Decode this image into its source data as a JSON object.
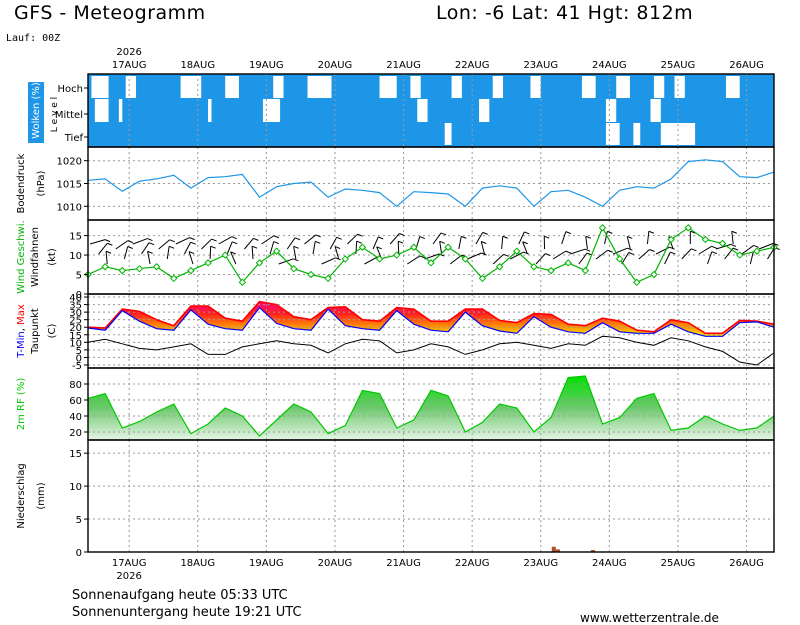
{
  "header": {
    "title_left": "GFS - Meteogramm",
    "title_right": "Lon: -6 Lat: 41 Hgt: 812m",
    "run": "Lauf: 00Z"
  },
  "footer": {
    "sunrise": "Sonnenaufgang heute 05:33 UTC",
    "sunset": "Sonnenuntergang heute 19:21 UTC",
    "website": "www.wetterzentrale.de"
  },
  "colors": {
    "cloud_sky": "#1E96E8",
    "pressure": "#1E96E8",
    "wind": "#00B400",
    "tmin": "#0000FF",
    "tmax": "#FF0000",
    "humidity": "#00C800",
    "precip": "#B45028",
    "grid": "#9A9A9A"
  },
  "chart_data": [
    {
      "type": "heatmap",
      "panel": "clouds",
      "ylabel": "Wolken (%)",
      "levels": [
        "Hoch",
        "Mittel",
        "Tief"
      ],
      "level_axis_label": "L e v e l",
      "x_year": "2026",
      "x": [
        "17AUG",
        "18AUG",
        "19AUG",
        "20AUG",
        "21AUG",
        "22AUG",
        "23AUG",
        "24AUG",
        "25AUG",
        "26AUG"
      ],
      "clear_patches": [
        {
          "level": "Hoch",
          "from": 0.05,
          "to": 0.3
        },
        {
          "level": "Hoch",
          "from": 0.55,
          "to": 0.7
        },
        {
          "level": "Hoch",
          "from": 1.35,
          "to": 1.65
        },
        {
          "level": "Hoch",
          "from": 2.0,
          "to": 2.2
        },
        {
          "level": "Hoch",
          "from": 2.7,
          "to": 2.85
        },
        {
          "level": "Hoch",
          "from": 3.2,
          "to": 3.55
        },
        {
          "level": "Hoch",
          "from": 4.25,
          "to": 4.5
        },
        {
          "level": "Hoch",
          "from": 4.7,
          "to": 4.85
        },
        {
          "level": "Hoch",
          "from": 5.3,
          "to": 5.45
        },
        {
          "level": "Hoch",
          "from": 5.9,
          "to": 6.05
        },
        {
          "level": "Hoch",
          "from": 6.45,
          "to": 6.6
        },
        {
          "level": "Hoch",
          "from": 7.2,
          "to": 7.4
        },
        {
          "level": "Hoch",
          "from": 7.7,
          "to": 7.9
        },
        {
          "level": "Hoch",
          "from": 8.25,
          "to": 8.4
        },
        {
          "level": "Hoch",
          "from": 8.55,
          "to": 8.7
        },
        {
          "level": "Hoch",
          "from": 9.3,
          "to": 9.5
        },
        {
          "level": "Mittel",
          "from": 0.1,
          "to": 0.3
        },
        {
          "level": "Mittel",
          "from": 0.45,
          "to": 0.5
        },
        {
          "level": "Mittel",
          "from": 1.75,
          "to": 1.8
        },
        {
          "level": "Mittel",
          "from": 2.55,
          "to": 2.8
        },
        {
          "level": "Mittel",
          "from": 4.8,
          "to": 4.95
        },
        {
          "level": "Mittel",
          "from": 5.7,
          "to": 5.85
        },
        {
          "level": "Mittel",
          "from": 7.55,
          "to": 7.7
        },
        {
          "level": "Mittel",
          "from": 8.2,
          "to": 8.35
        },
        {
          "level": "Tief",
          "from": 5.2,
          "to": 5.3
        },
        {
          "level": "Tief",
          "from": 7.55,
          "to": 7.75
        },
        {
          "level": "Tief",
          "from": 7.95,
          "to": 8.05
        },
        {
          "level": "Tief",
          "from": 8.35,
          "to": 8.85
        }
      ]
    },
    {
      "type": "line",
      "panel": "pressure",
      "ylabel": "Bodendruck",
      "unit": "(hPa)",
      "ylim": [
        1007,
        1023
      ],
      "yticks": [
        1010,
        1015,
        1020
      ],
      "x_day_offset": [
        0,
        0.25,
        0.5,
        0.75,
        1,
        1.25,
        1.5,
        1.75,
        2,
        2.25,
        2.5,
        2.75,
        3,
        3.25,
        3.5,
        3.75,
        4,
        4.25,
        4.5,
        4.75,
        5,
        5.25,
        5.5,
        5.75,
        6,
        6.25,
        6.5,
        6.75,
        7,
        7.25,
        7.5,
        7.75,
        8,
        8.25,
        8.5,
        8.75,
        9,
        9.25,
        9.5,
        9.75,
        10
      ],
      "values": [
        1015.7,
        1016.0,
        1013.3,
        1015.5,
        1016.0,
        1016.8,
        1014.0,
        1016.3,
        1016.5,
        1017.0,
        1012.0,
        1014.3,
        1015.0,
        1015.3,
        1012.0,
        1013.8,
        1013.5,
        1013.0,
        1010.0,
        1013.2,
        1013.0,
        1012.7,
        1010.0,
        1014.0,
        1014.5,
        1014.0,
        1010.0,
        1013.2,
        1013.5,
        1012.0,
        1010.0,
        1013.5,
        1014.3,
        1014.0,
        1016.0,
        1019.8,
        1020.2,
        1019.8,
        1016.5,
        1016.3,
        1017.5
      ]
    },
    {
      "type": "line",
      "panel": "wind",
      "ylabel": "Wind Geschwi.",
      "ylabel2": "Windfahnen",
      "unit": "(kt)",
      "ylim": [
        0,
        19
      ],
      "yticks": [
        0,
        5,
        10,
        15
      ],
      "x_day_offset": [
        0,
        0.25,
        0.5,
        0.75,
        1,
        1.25,
        1.5,
        1.75,
        2,
        2.25,
        2.5,
        2.75,
        3,
        3.25,
        3.5,
        3.75,
        4,
        4.25,
        4.5,
        4.75,
        5,
        5.25,
        5.5,
        5.75,
        6,
        6.25,
        6.5,
        6.75,
        7,
        7.25,
        7.5,
        7.75,
        8,
        8.25,
        8.5,
        8.75,
        9,
        9.25,
        9.5,
        9.75,
        10
      ],
      "values": [
        5.0,
        7.0,
        6.0,
        6.5,
        7.0,
        4.0,
        6.0,
        8.0,
        10.0,
        3.0,
        8.0,
        11.0,
        6.5,
        5.0,
        4.0,
        9.0,
        12.0,
        9.0,
        10.0,
        12.0,
        8.0,
        12.0,
        9.0,
        4.0,
        7.0,
        11.0,
        7.0,
        6.0,
        8.0,
        6.0,
        17.0,
        9.0,
        3.0,
        5.0,
        14.0,
        17.0,
        14.0,
        13.0,
        10.0,
        11.0,
        12.0
      ]
    },
    {
      "type": "area",
      "panel": "temperature",
      "ylabel": "T-Min, Max",
      "ylabel_parts": {
        "sep": ", "
      },
      "ylabel2": "Taupunkt",
      "unit": "(C)",
      "ylim": [
        -7,
        42
      ],
      "yticks": [
        -5,
        0,
        5,
        10,
        15,
        20,
        25,
        30,
        35,
        40
      ],
      "x_day_offset": [
        0,
        0.25,
        0.5,
        0.75,
        1,
        1.25,
        1.5,
        1.75,
        2,
        2.25,
        2.5,
        2.75,
        3,
        3.25,
        3.5,
        3.75,
        4,
        4.25,
        4.5,
        4.75,
        5,
        5.25,
        5.5,
        5.75,
        6,
        6.25,
        6.5,
        6.75,
        7,
        7.25,
        7.5,
        7.75,
        8,
        8.25,
        8.5,
        8.75,
        9,
        9.25,
        9.5,
        9.75,
        10
      ],
      "series": [
        {
          "name": "T-Min",
          "values": [
            19.5,
            18.0,
            31.0,
            24.0,
            19.0,
            18.0,
            31.5,
            22.0,
            19.0,
            18.0,
            33.0,
            22.5,
            19.0,
            18.0,
            32.0,
            21.0,
            19.0,
            18.0,
            31.0,
            22.0,
            18.0,
            17.0,
            30.0,
            21.0,
            17.5,
            16.0,
            27.0,
            20.0,
            17.0,
            16.0,
            23.0,
            17.0,
            16.0,
            16.0,
            22.0,
            17.0,
            14.0,
            14.0,
            23.0,
            23.5,
            20.0
          ]
        },
        {
          "name": "T-Max",
          "values": [
            20.0,
            19.5,
            32.0,
            30.5,
            25.0,
            21.0,
            34.0,
            34.0,
            26.0,
            24.0,
            37.0,
            35.0,
            27.0,
            25.0,
            33.0,
            33.5,
            25.0,
            24.0,
            33.0,
            32.0,
            24.0,
            24.0,
            32.0,
            32.0,
            24.5,
            23.0,
            29.0,
            28.5,
            22.0,
            21.0,
            26.0,
            24.0,
            18.0,
            17.0,
            25.0,
            23.0,
            16.0,
            16.0,
            24.5,
            24.0,
            22.0
          ]
        },
        {
          "name": "Taupunkt",
          "values": [
            10.0,
            12.0,
            9.0,
            6.0,
            5.0,
            7.0,
            9.0,
            2.0,
            2.0,
            7.0,
            9.0,
            11.0,
            9.0,
            8.0,
            3.0,
            9.0,
            12.0,
            11.0,
            3.0,
            5.0,
            9.0,
            7.0,
            2.0,
            5.0,
            9.0,
            10.0,
            8.0,
            6.0,
            9.0,
            8.0,
            14.0,
            13.0,
            10.0,
            8.0,
            13.0,
            11.0,
            7.0,
            4.0,
            -3.0,
            -5.0,
            3.0
          ]
        }
      ]
    },
    {
      "type": "area",
      "panel": "humidity",
      "ylabel": "2m RF (%)",
      "ylim": [
        10,
        100
      ],
      "yticks": [
        20,
        40,
        60,
        80
      ],
      "x_day_offset": [
        0,
        0.25,
        0.5,
        0.75,
        1,
        1.25,
        1.5,
        1.75,
        2,
        2.25,
        2.5,
        2.75,
        3,
        3.25,
        3.5,
        3.75,
        4,
        4.25,
        4.5,
        4.75,
        5,
        5.25,
        5.5,
        5.75,
        6,
        6.25,
        6.5,
        6.75,
        7,
        7.25,
        7.5,
        7.75,
        8,
        8.25,
        8.5,
        8.75,
        9,
        9.25,
        9.5,
        9.75,
        10
      ],
      "values": [
        62,
        68,
        25,
        33,
        45,
        55,
        18,
        30,
        50,
        40,
        15,
        35,
        55,
        45,
        18,
        28,
        72,
        68,
        25,
        35,
        72,
        65,
        20,
        32,
        55,
        50,
        20,
        38,
        88,
        90,
        30,
        38,
        62,
        68,
        22,
        25,
        40,
        30,
        22,
        25,
        40
      ]
    },
    {
      "type": "bar",
      "panel": "precipitation",
      "ylabel": "Niederschlag",
      "unit": "(mm)",
      "ylim": [
        0,
        17
      ],
      "yticks": [
        0,
        5,
        10,
        15
      ],
      "x_day_offset": [
        6.79,
        6.85,
        7.36
      ],
      "values": [
        0.8,
        0.4,
        0.3
      ]
    }
  ]
}
